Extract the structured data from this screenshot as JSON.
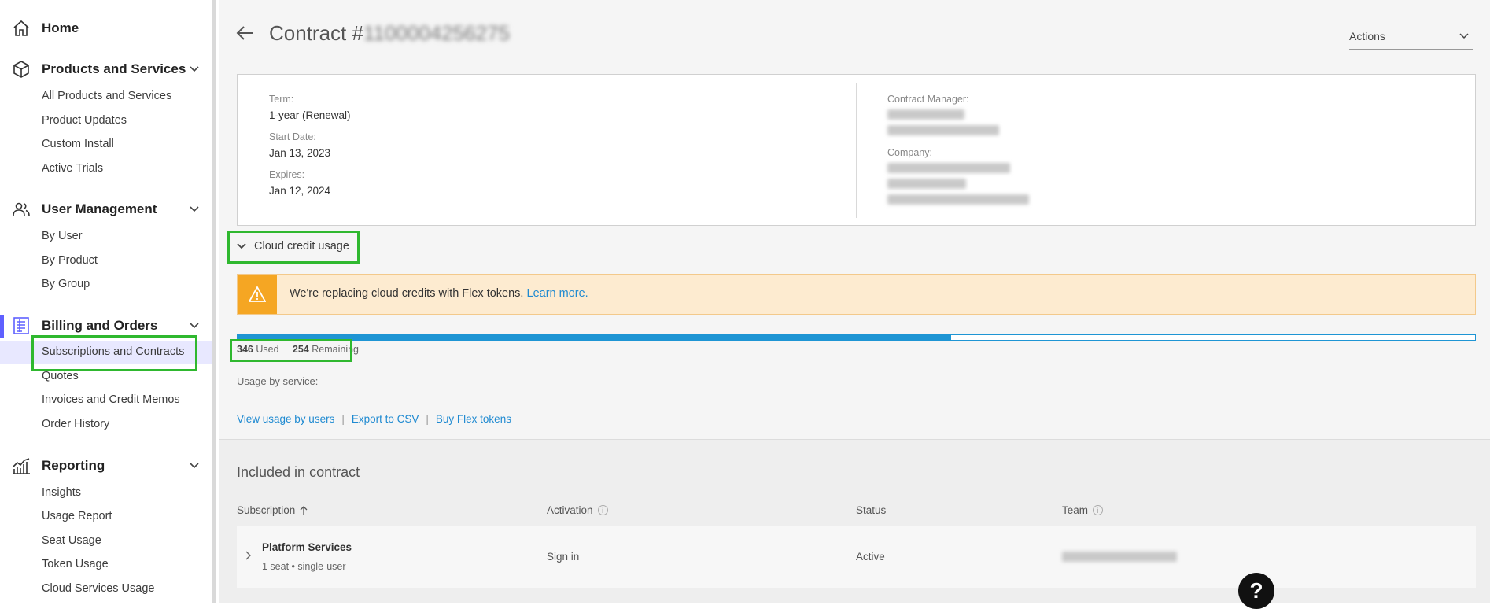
{
  "sidebar": {
    "home": "Home",
    "products": {
      "label": "Products and Services",
      "items": [
        "All Products and Services",
        "Product Updates",
        "Custom Install",
        "Active Trials"
      ]
    },
    "users": {
      "label": "User Management",
      "items": [
        "By User",
        "By Product",
        "By Group"
      ]
    },
    "billing": {
      "label": "Billing and Orders",
      "items": [
        "Subscriptions and Contracts",
        "Quotes",
        "Invoices and Credit Memos",
        "Order History"
      ]
    },
    "reporting": {
      "label": "Reporting",
      "items": [
        "Insights",
        "Usage Report",
        "Seat Usage",
        "Token Usage",
        "Cloud Services Usage"
      ]
    },
    "selected_item": "Subscriptions and Contracts"
  },
  "header": {
    "title_prefix": "Contract #",
    "contract_number_redacted": "1100004256275",
    "actions_label": "Actions"
  },
  "details": {
    "term_label": "Term:",
    "term_value": "1-year (Renewal)",
    "start_label": "Start Date:",
    "start_value": "Jan 13, 2023",
    "expires_label": "Expires:",
    "expires_value": "Jan 12, 2024",
    "manager_label": "Contract Manager:",
    "company_label": "Company:"
  },
  "credits": {
    "section_label": "Cloud credit usage",
    "banner_text": "We're replacing cloud credits with Flex tokens.",
    "banner_link": "Learn more.",
    "used_value": "346",
    "used_label": "Used",
    "remaining_value": "254",
    "remaining_label": "Remaining",
    "used_fraction": 0.5767,
    "usage_by_service_label": "Usage by service:",
    "links": [
      "View usage by users",
      "Export to CSV",
      "Buy Flex tokens"
    ]
  },
  "contract_items": {
    "heading": "Included in contract",
    "columns": [
      "Subscription",
      "Activation",
      "Status",
      "Team"
    ],
    "rows": [
      {
        "name": "Platform Services",
        "detail": "1 seat • single-user",
        "activation": "Sign in",
        "status": "Active"
      }
    ]
  },
  "help_label": "?",
  "colors": {
    "accent": "#5f60ff",
    "highlight": "#2fb82f",
    "progress": "#1e95d4",
    "warning": "#f5a623",
    "link": "#1f8ad1"
  }
}
